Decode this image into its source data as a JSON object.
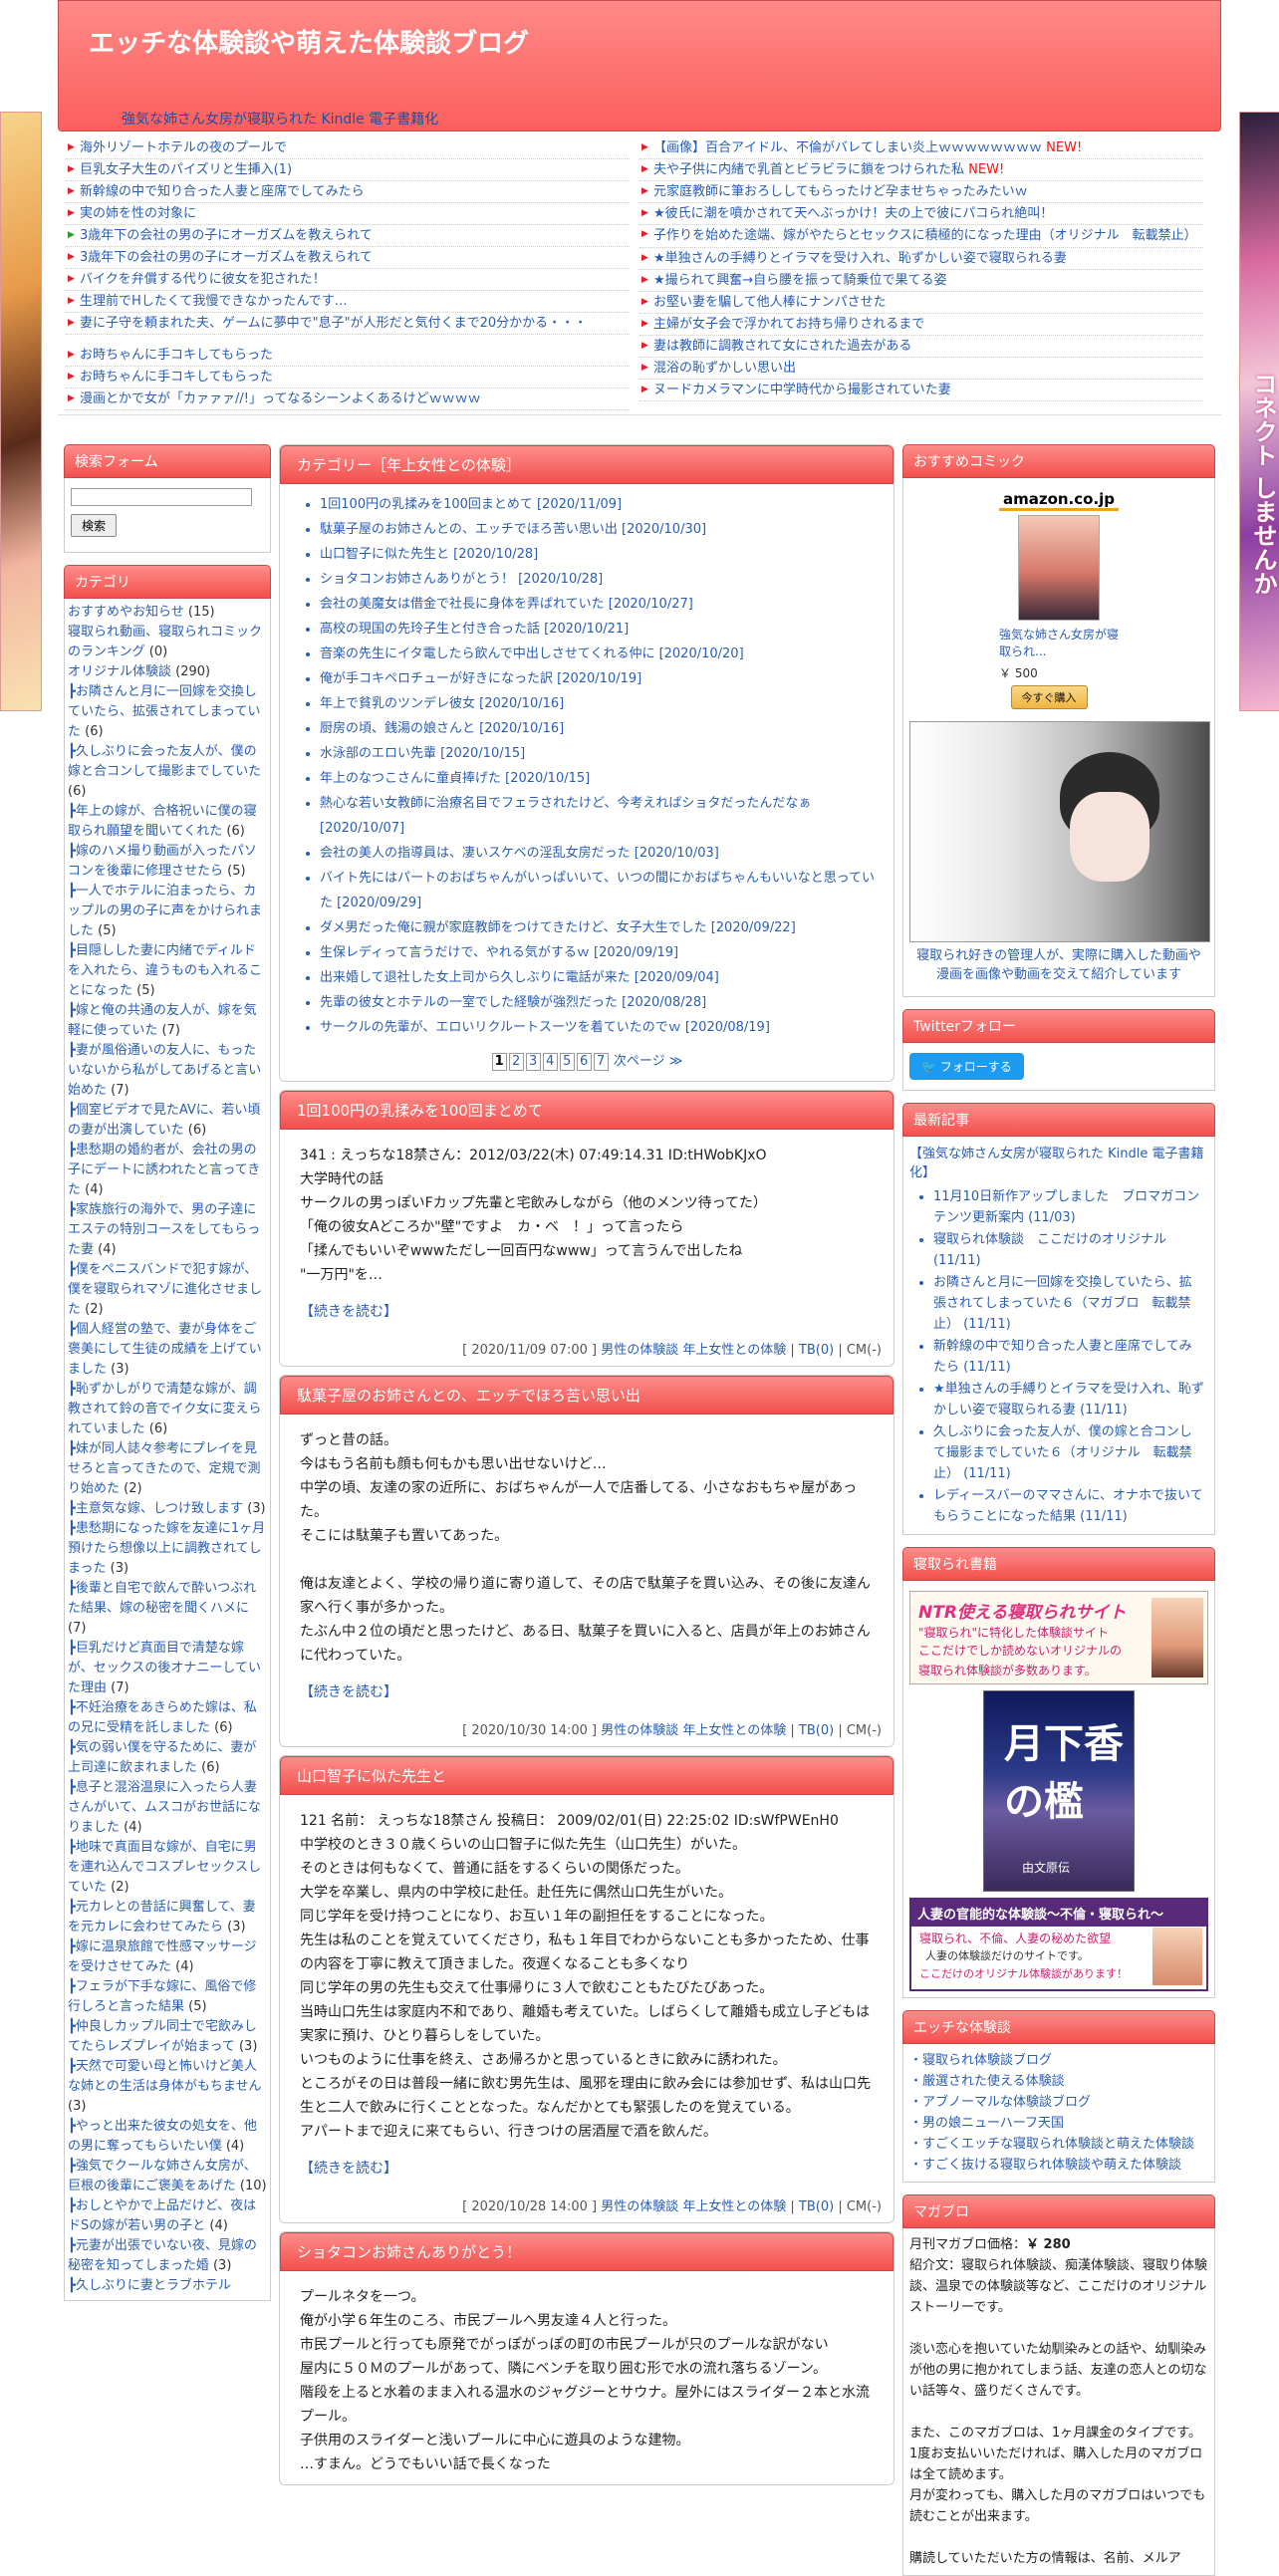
{
  "site": {
    "title": "エッチな体験談や萌えた体験談ブログ",
    "subtitle_link": "強気な姉さん女房が寝取られた Kindle 電子書籍化"
  },
  "top_links": {
    "left": [
      {
        "text": "海外リゾートホテルの夜のプールで"
      },
      {
        "text": "巨乳女子大生のパイズリと生挿入(1)"
      },
      {
        "text": "新幹線の中で知り合った人妻と座席でしてみたら"
      },
      {
        "text": "実の姉を性の対象に"
      },
      {
        "text": "3歳年下の会社の男の子にオーガズムを教えられて"
      },
      {
        "text": "3歳年下の会社の男の子にオーガズムを教えられて"
      },
      {
        "text": "バイクを弁償する代りに彼女を犯された！"
      },
      {
        "text": "生理前でHしたくて我慢できなかったんです…"
      },
      {
        "text": "妻に子守を頼まれた夫、ゲームに夢中で\"息子\"が人形だと気付くまで20分かかる・・・"
      },
      {
        "text": "お時ちゃんに手コキしてもらった"
      },
      {
        "text": "お時ちゃんに手コキしてもらった"
      },
      {
        "text": "漫画とかで女が「カァァァ//!」ってなるシーンよくあるけどｗｗｗｗ"
      }
    ],
    "right": [
      {
        "text": "【画像】百合アイドル、不倫がバレてしまい炎上ｗｗｗｗｗｗｗｗ",
        "badge": "NEW!"
      },
      {
        "text": "夫や子供に内緒で乳首とビラビラに鎖をつけられた私",
        "badge": "NEW!"
      },
      {
        "text": "元家庭教師に筆おろししてもらったけど孕ませちゃったみたいｗ"
      },
      {
        "text": "★彼氏に潮を噴かされて天へぶっかけ！夫の上で彼にパコられ絶叫！"
      },
      {
        "text": "子作りを始めた途端、嫁がやたらとセックスに積極的になった理由（オリジナル　転載禁止）"
      },
      {
        "text": "★単独さんの手縛りとイラマを受け入れ、恥ずかしい姿で寝取られる妻"
      },
      {
        "text": "★撮られて興奮→自ら腰を振って騎乗位で果てる姿"
      },
      {
        "text": "お堅い妻を騙して他人棒にナンパさせた"
      },
      {
        "text": "主婦が女子会で浮かれてお持ち帰りされるまで"
      },
      {
        "text": "妻は教師に調教されて女にされた過去がある"
      },
      {
        "text": "混浴の恥ずかしい思い出"
      },
      {
        "text": "ヌードカメラマンに中学時代から撮影されていた妻"
      }
    ]
  },
  "search": {
    "heading": "検索フォーム",
    "button": "検索",
    "value": ""
  },
  "categories": {
    "heading": "カテゴリ",
    "items": [
      {
        "name": "おすすめやお知らせ",
        "count": "(15)"
      },
      {
        "name": "寝取られ動画、寝取られコミックのランキング",
        "count": "(0)"
      },
      {
        "name": "オリジナル体験談",
        "count": "(290)"
      },
      {
        "name": "┣お隣さんと月に一回嫁を交換していたら、拡張されてしまっていた",
        "count": "(6)"
      },
      {
        "name": "┣久しぶりに会った友人が、僕の嫁と合コンして撮影までしていた",
        "count": "(6)"
      },
      {
        "name": "┣年上の嫁が、合格祝いに僕の寝取られ願望を聞いてくれた",
        "count": "(6)"
      },
      {
        "name": "┣嫁のハメ撮り動画が入ったパソコンを後輩に修理させたら",
        "count": "(5)"
      },
      {
        "name": "┣一人でホテルに泊まったら、カップルの男の子に声をかけられました",
        "count": "(5)"
      },
      {
        "name": "┣目隠しした妻に内緒でディルドを入れたら、違うものも入れることになった",
        "count": "(5)"
      },
      {
        "name": "┣嫁と俺の共通の友人が、嫁を気軽に使っていた",
        "count": "(7)"
      },
      {
        "name": "┣妻が風俗通いの友人に、もったいないから私がしてあげると言い始めた",
        "count": "(7)"
      },
      {
        "name": "┣個室ビデオで見たAVに、若い頃の妻が出演していた",
        "count": "(6)"
      },
      {
        "name": "┣患愁期の婚約者が、会社の男の子にデートに誘われたと言ってきた",
        "count": "(4)"
      },
      {
        "name": "┣家族旅行の海外で、男の子達にエステの特別コースをしてもらった妻",
        "count": "(4)"
      },
      {
        "name": "┣僕をペニスバンドで犯す嫁が、僕を寝取られマゾに進化させました",
        "count": "(2)"
      },
      {
        "name": "┣個人経営の塾で、妻が身体をご褒美にして生徒の成績を上げていました",
        "count": "(3)"
      },
      {
        "name": "┣恥ずかしがりで清楚な嫁が、調教されて鈴の音でイク女に変えられていました",
        "count": "(6)"
      },
      {
        "name": "┣妹が同人誌々参考にプレイを見せろと言ってきたので、定規で測り始めた",
        "count": "(2)"
      },
      {
        "name": "┣主意気な嫁、しつけ致します",
        "count": "(3)"
      },
      {
        "name": "┣患愁期になった嫁を友達に1ヶ月預けたら想像以上に調教されてしまった",
        "count": "(3)"
      },
      {
        "name": "┣後輩と自宅で飲んで酔いつぶれた結果、嫁の秘密を聞くハメに",
        "count": "(7)"
      },
      {
        "name": "┣巨乳だけど真面目で清楚な嫁が、セックスの後オナニーしていた理由",
        "count": "(7)"
      },
      {
        "name": "┣不妊治療をあきらめた嫁は、私の兄に受精を託しました",
        "count": "(6)"
      },
      {
        "name": "┣気の弱い僕を守るために、妻が上司達に飲まれました",
        "count": "(6)"
      },
      {
        "name": "┣息子と混浴温泉に入ったら人妻さんがいて、ムスコがお世話になりました",
        "count": "(4)"
      },
      {
        "name": "┣地味で真面目な嫁が、自宅に男を連れ込んでコスプレセックスしていた",
        "count": "(2)"
      },
      {
        "name": "┣元カレとの昔話に興奮して、妻を元カレに会わせてみたら",
        "count": "(3)"
      },
      {
        "name": "┣嫁に温泉旅館で性感マッサージを受けさせてみた",
        "count": "(4)"
      },
      {
        "name": "┣フェラが下手な嫁に、風俗で修行しろと言った結果",
        "count": "(5)"
      },
      {
        "name": "┣仲良しカップル同士で宅飲みしてたらレズプレイが始まって",
        "count": "(3)"
      },
      {
        "name": "┣天然で可愛い母と怖いけど美人な姉との生活は身体がもちません",
        "count": "(3)"
      },
      {
        "name": "┣やっと出来た彼女の処女を、他の男に奪ってもらいたい僕",
        "count": "(4)"
      },
      {
        "name": "┣強気でクールな姉さん女房が、巨根の後輩にご褒美をあげた",
        "count": "(10)"
      },
      {
        "name": "┣おしとやかで上品だけど、夜はドSの嫁が若い男の子と",
        "count": "(4)"
      },
      {
        "name": "┣元妻が出張でいない夜、見嫁の秘密を知ってしまった婚",
        "count": "(3)"
      },
      {
        "name": "┣久しぶりに妻とラブホテル"
      }
    ]
  },
  "category_box": {
    "heading": "カテゴリー［年上女性との体験］",
    "items": [
      "1回100円の乳揉みを100回まとめて [2020/11/09]",
      "駄菓子屋のお姉さんとの、エッチでほろ苦い思い出 [2020/10/30]",
      "山口智子に似た先生と [2020/10/28]",
      "ショタコンお姉さんありがとう！ [2020/10/28]",
      "会社の美魔女は借金で社長に身体を弄ばれていた [2020/10/27]",
      "高校の現国の先玲子生と付き合った話 [2020/10/21]",
      "音楽の先生にイタ電したら飲んで中出しさせてくれる仲に [2020/10/20]",
      "俺が手コキペロチューが好きになった訳 [2020/10/19]",
      "年上で貧乳のツンデレ彼女 [2020/10/16]",
      "厨房の頃、銭湯の娘さんと [2020/10/16]",
      "水泳部のエロい先輩 [2020/10/15]",
      "年上のなつこさんに童貞捧げた [2020/10/15]",
      "熱心な若い女教師に治療名目でフェラされたけど、今考えればショタだったんだなぁ [2020/10/07]",
      "会社の美人の指導員は、凄いスケベの淫乱女房だった [2020/10/03]",
      "バイト先にはパートのおばちゃんがいっぱいいて、いつの間にかおばちゃんもいいなと思っていた [2020/09/29]",
      "ダメ男だった俺に親が家庭教師をつけてきたけど、女子大生でした [2020/09/22]",
      "生保レディって言うだけで、やれる気がするｗ [2020/09/19]",
      "出来婚して退社した女上司から久しぶりに電話が来た [2020/09/04]",
      "先輩の彼女とホテルの一室でした経験が強烈だった [2020/08/28]",
      "サークルの先輩が、エロいリクルートスーツを着ていたのでｗ [2020/08/19]"
    ],
    "pages": [
      "1",
      "2",
      "3",
      "4",
      "5",
      "6",
      "7"
    ],
    "next": "次ページ ≫"
  },
  "entries": [
    {
      "title": "1回100円の乳揉みを100回まとめて",
      "body": "341 : えっちな18禁さん：2012/03/22(木) 07:49:14.31 ID:tHWobKJxO\n大学時代の話\nサークルの男っぽいFカップ先輩と宅飲みしながら（他のメンツ待ってた）\n「俺の彼女Aどころか\"壁\"ですよ　カ・ベ　！」って言ったら\n「揉んでもいいぞwwwただし一回百円なwww」って言うんで出したね\n\"一万円\"を…",
      "more": "【続きを読む】",
      "date": "[ 2020/11/09 07:00 ]",
      "cat1": "男性の体験談",
      "cat2": "年上女性との体験",
      "tb": "TB(0)",
      "cm": "CM(-)"
    },
    {
      "title": "駄菓子屋のお姉さんとの、エッチでほろ苦い思い出",
      "body": "ずっと昔の話。\n今はもう名前も顔も何もかも思い出せないけど…\n中学の頃、友達の家の近所に、おばちゃんが一人で店番してる、小さなおもちゃ屋があった。\nそこには駄菓子も置いてあった。\n\n俺は友達とよく、学校の帰り道に寄り道して、その店で駄菓子を買い込み、その後に友達ん家へ行く事が多かった。\nたぶん中２位の頃だと思ったけど、ある日、駄菓子を買いに入ると、店員が年上のお姉さんに代わっていた。",
      "more": "【続きを読む】",
      "date": "[ 2020/10/30 14:00 ]",
      "cat1": "男性の体験談",
      "cat2": "年上女性との体験",
      "tb": "TB(0)",
      "cm": "CM(-)"
    },
    {
      "title": "山口智子に似た先生と",
      "body": "121 名前： えっちな18禁さん 投稿日： 2009/02/01(日) 22:25:02 ID:sWfPWEnH0\n中学校のとき３０歳くらいの山口智子に似た先生（山口先生）がいた。\nそのときは何もなくて、普通に話をするくらいの関係だった。\n大学を卒業し、県内の中学校に赴任。赴任先に偶然山口先生がいた。\n同じ学年を受け持つことになり、お互い１年の副担任をすることになった。\n先生は私のことを覚えていてくださり，私も１年目でわからないことも多かったため、仕事の内容を丁寧に教えて頂きました。夜遅くなることも多くなり\n同じ学年の男の先生も交えて仕事帰りに３人で飲むこともたびたびあった。\n当時山口先生は家庭内不和であり、離婚も考えていた。しばらくして離婚も成立し子どもは実家に預け、ひとり暮らしをしていた。\nいつものように仕事を終え、さあ帰ろかと思っているときに飲みに誘われた。\nところがその日は普段一緒に飲む男先生は、風邪を理由に飲み会には参加せず、私は山口先生と二人で飲みに行くこととなった。なんだかとても緊張したのを覚えている。\nアパートまで迎えに来てもらい、行きつけの居酒屋で酒を飲んだ。",
      "more": "【続きを読む】",
      "date": "[ 2020/10/28 14:00 ]",
      "cat1": "男性の体験談",
      "cat2": "年上女性との体験",
      "tb": "TB(0)",
      "cm": "CM(-)"
    },
    {
      "title": "ショタコンお姉さんありがとう！",
      "body": "プールネタを一つ。\n俺が小学６年生のころ、市民プールへ男友達４人と行った。\n市民プールと行っても原発でがっぽがっぽの町の市民プールが只のプールな訳がない\n屋内に５０Ｍのプールがあって、隣にベンチを取り囲む形で水の流れ落ちるゾーン。\n階段を上ると水着のまま入れる温水のジャグジーとサウナ。屋外にはスライダー２本と水流プール。\n子供用のスライダーと浅いプールに中心に遊具のような建物。\n…すまん。どうでもいい話で長くなった"
    }
  ],
  "right": {
    "comic_heading": "おすすめコミック",
    "amazon_logo": "amazon.co.jp",
    "book_title": "強気な姉さん女房が寝取られ...",
    "book_price": "￥ 500",
    "buy_label": "今すぐ購入",
    "manga_caption": "寝取られ好きの管理人が、実際に購入した動画や漫画を画像や動画を交えて紹介しています",
    "twitter_heading": "Twitterフォロー",
    "follow_label": "フォローする",
    "recent_heading": "最新記事",
    "recent_top": "【強気な姉さん女房が寝取られた Kindle 電子書籍化】",
    "recent_items": [
      "11月10日新作アップしました　ブロマガコンテンツ更新案内 (11/03)",
      "寝取られ体験談　ここだけのオリジナル (11/11)",
      "お隣さんと月に一回嫁を交換していたら、拡張されてしまっていた６（マガブロ　転載禁止） (11/11)",
      "新幹線の中で知り合った人妻と座席でしてみたら (11/11)",
      "★単独さんの手縛りとイラマを受け入れ、恥ずかしい姿で寝取られる妻 (11/11)",
      "久しぶりに会った友人が、僕の嫁と合コンして撮影までしていた６（オリジナル　転載禁止） (11/11)",
      "レディースバーのママさんに、オナホで抜いてもらうことになった結果 (11/11)"
    ],
    "books_heading": "寝取られ書籍",
    "banner1": {
      "t1": "NTR使える寝取られサイト",
      "t2": "\"寝取られ\"に特化した体験談サイト",
      "t3": "ここだけでしか読めないオリジナルの",
      "t4": "寝取られ体験談が多数あります。"
    },
    "banner2": {
      "big": "月下香の檻",
      "small": "由文原伝"
    },
    "banner3": {
      "t1": "人妻の官能的な体験談〜不倫・寝取られ〜",
      "t2": "寝取られ、不倫、人妻の秘めた欲望",
      "t3": "人妻の体験談だけのサイトです。",
      "t4": "ここだけのオリジナル体験談があります！"
    },
    "h_heading": "エッチな体験談",
    "h_links": [
      "・寝取られ体験談ブログ",
      "・厳選された使える体験談",
      "・アブノーマルな体験談ブログ",
      "・男の娘ニューハーフ天国",
      "・すごくエッチな寝取られ体験談と萌えた体験談",
      "・すごく抜ける寝取られ体験談や萌えた体験談"
    ],
    "mag_heading": "マガブロ",
    "mag_price_label": "月刊マガブロ価格：",
    "mag_price": "￥ 280",
    "mag_text": "紹介文：寝取られ体験談、痴漢体験談、寝取り体験談、温泉での体験談等など、ここだけのオリジナルストーリーです。\n\n淡い恋心を抱いていた幼馴染みとの話や、幼馴染みが他の男に抱かれてしまう話、友達の恋人との切ない話等々、盛りだくさんです。\n\nまた、このマガブロは、1ヶ月課金のタイプです。\n1度お支払いいただければ、購入した月のマガブロは全て読めます。\n月が変わっても、購入した月のマガブロはいつでも読むことが出来ます。\n\n購読していただいた方の情報は、名前、メルア"
  },
  "side_ad": {
    "left_text": "",
    "right_text": "コネクト しませんか"
  }
}
